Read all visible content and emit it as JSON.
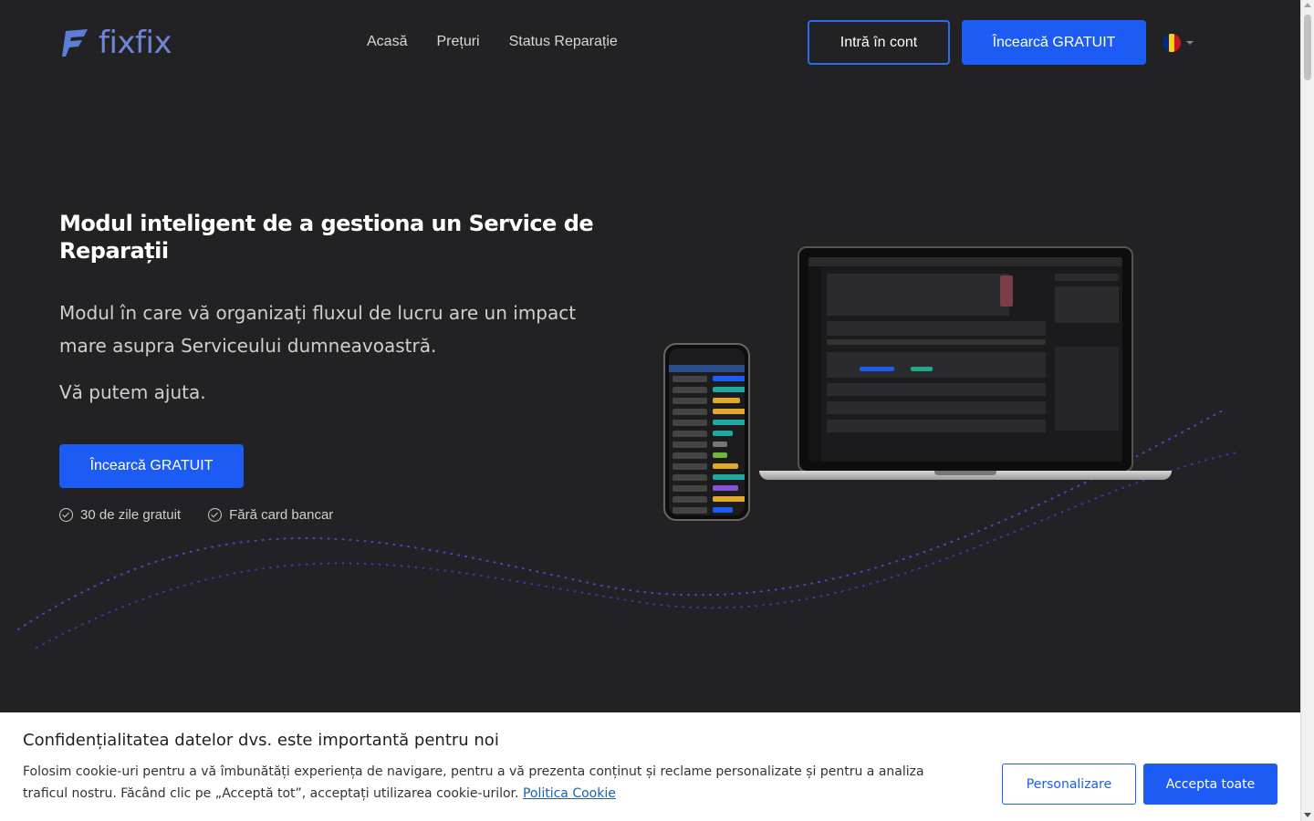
{
  "brand": {
    "name": "fixfix",
    "accent": "#1c5cf5",
    "logo_color": "#6f86d6"
  },
  "nav": {
    "items": [
      {
        "label": "Acasă"
      },
      {
        "label": "Prețuri"
      },
      {
        "label": "Status Reparație"
      }
    ],
    "login_label": "Intră în cont",
    "try_label": "Încearcă GRATUIT",
    "language_icon": "romania-flag-icon"
  },
  "hero": {
    "title": "Modul inteligent de a gestiona un Service de Reparații",
    "subtitle": "Modul în care vă organizați fluxul de lucru are un impact mare asupra Serviceului dumneavoastră.",
    "help": "Vă putem ajuta.",
    "cta_label": "Încearcă GRATUIT",
    "perks": [
      {
        "label": "30 de zile gratuit",
        "icon": "check-circle-icon"
      },
      {
        "label": "Fără card bancar",
        "icon": "check-circle-icon"
      }
    ]
  },
  "cookie": {
    "title": "Confidențialitatea datelor dvs. este importantă pentru noi",
    "text": "Folosim cookie-uri pentru a vă îmbunătăți experiența de navigare, pentru a vă prezenta conținut și reclame personalizate și pentru a analiza traficul nostru. Făcând clic pe „Acceptă tot”, acceptați utilizarea cookie-urilor.",
    "link_label": "Politica Cookie",
    "customize_label": "Personalizare",
    "accept_label": "Accepta toate"
  }
}
